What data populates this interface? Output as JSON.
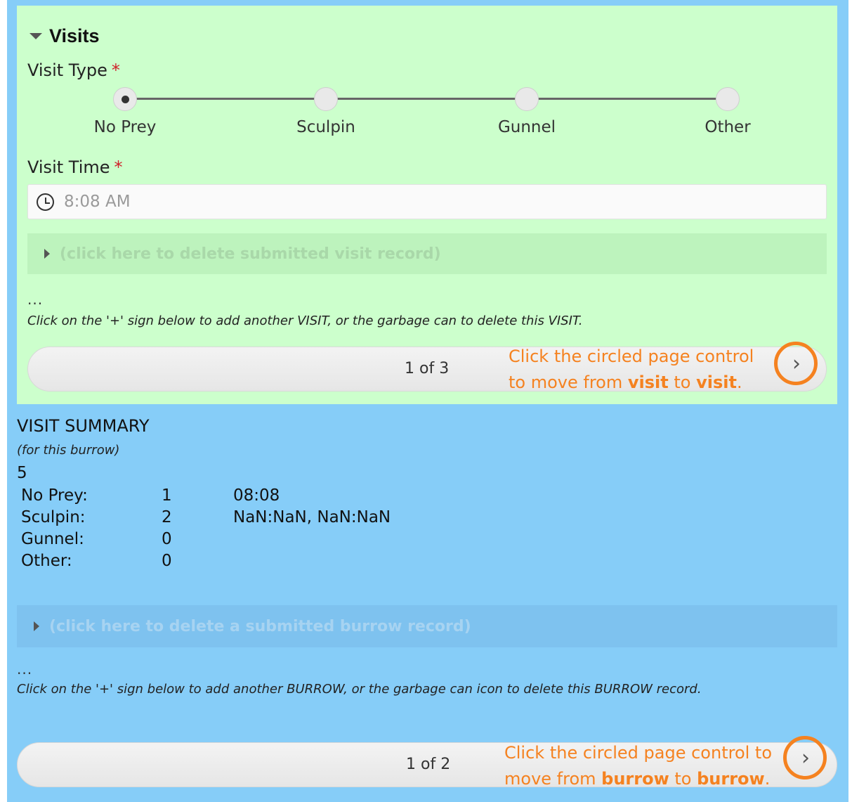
{
  "visits_group": {
    "title": "Visits",
    "visit_type": {
      "label": "Visit Type",
      "required_mark": "*",
      "options": [
        "No Prey",
        "Sculpin",
        "Gunnel",
        "Other"
      ],
      "selected": "No Prey"
    },
    "visit_time": {
      "label": "Visit Time",
      "required_mark": "*",
      "value": "8:08 AM",
      "icon": "clock-icon"
    },
    "delete_toggle_label": "(click here to delete submitted visit record)",
    "ellipsis": "...",
    "hint": "Click on the '+' sign below to add another VISIT, or the garbage can to delete this VISIT.",
    "pager": {
      "count": "1 of 3",
      "next_icon": "chevron-right-icon",
      "annotation": {
        "line1": "Click the circled page control",
        "line2_pre": "to move from ",
        "bold1": "visit",
        "mid": " to ",
        "bold2": "visit",
        "end": "."
      }
    }
  },
  "summary": {
    "title": "VISIT SUMMARY",
    "subtitle": "(for this burrow)",
    "total": "5",
    "rows": [
      {
        "label": "No Prey:",
        "count": "1",
        "times": "08:08"
      },
      {
        "label": "Sculpin:",
        "count": "2",
        "times": "NaN:NaN, NaN:NaN"
      },
      {
        "label": "Gunnel:",
        "count": "0",
        "times": ""
      },
      {
        "label": "Other:",
        "count": "0",
        "times": ""
      }
    ]
  },
  "burrow": {
    "delete_toggle_label": "(click here to delete a submitted burrow record)",
    "ellipsis": "...",
    "hint": "Click on the '+' sign below to add another BURROW, or the garbage can icon to delete this BURROW record.",
    "pager": {
      "count": "1 of 2",
      "next_icon": "chevron-right-icon",
      "annotation": {
        "line1": "Click the circled page control to",
        "line2_pre": "move from ",
        "bold1": "burrow",
        "mid": " to ",
        "bold2": "burrow",
        "end": "."
      }
    }
  },
  "colors": {
    "visit_group_bg": "#ccffcc",
    "page_bg": "#86cdf8",
    "annotation": "#f58220",
    "required": "#d0202a"
  }
}
